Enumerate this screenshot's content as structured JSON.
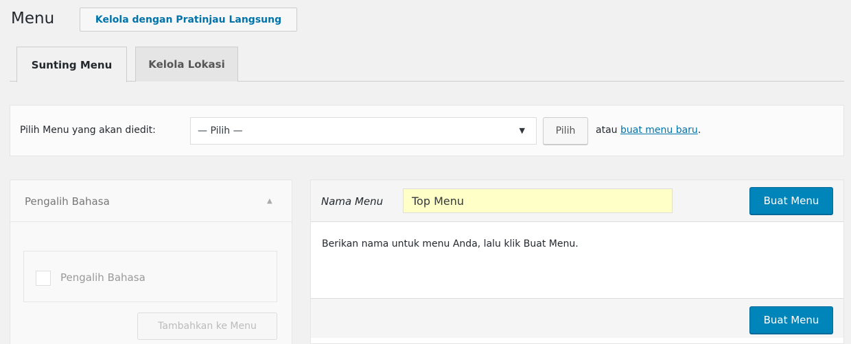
{
  "header": {
    "title": "Menu",
    "action_button": "Kelola dengan Pratinjau Langsung"
  },
  "tabs": [
    {
      "label": "Sunting Menu",
      "active": true
    },
    {
      "label": "Kelola Lokasi",
      "active": false
    }
  ],
  "manage": {
    "label": "Pilih Menu yang akan diedit:",
    "select_value": "— Pilih —",
    "button": "Pilih",
    "or_text": "atau",
    "create_link": "buat menu baru",
    "period": "."
  },
  "left_panel": {
    "title": "Pengalih Bahasa",
    "checkbox_label": "Pengalih Bahasa",
    "add_button": "Tambahkan ke Menu"
  },
  "right_panel": {
    "name_label": "Nama Menu",
    "name_value": "Top Menu",
    "create_button_top": "Buat Menu",
    "instruction": "Berikan nama untuk menu Anda, lalu klik Buat Menu.",
    "create_button_bottom": "Buat Menu"
  },
  "colors": {
    "accent": "#0085ba",
    "link": "#0073aa",
    "input_highlight": "#ffffc8"
  }
}
